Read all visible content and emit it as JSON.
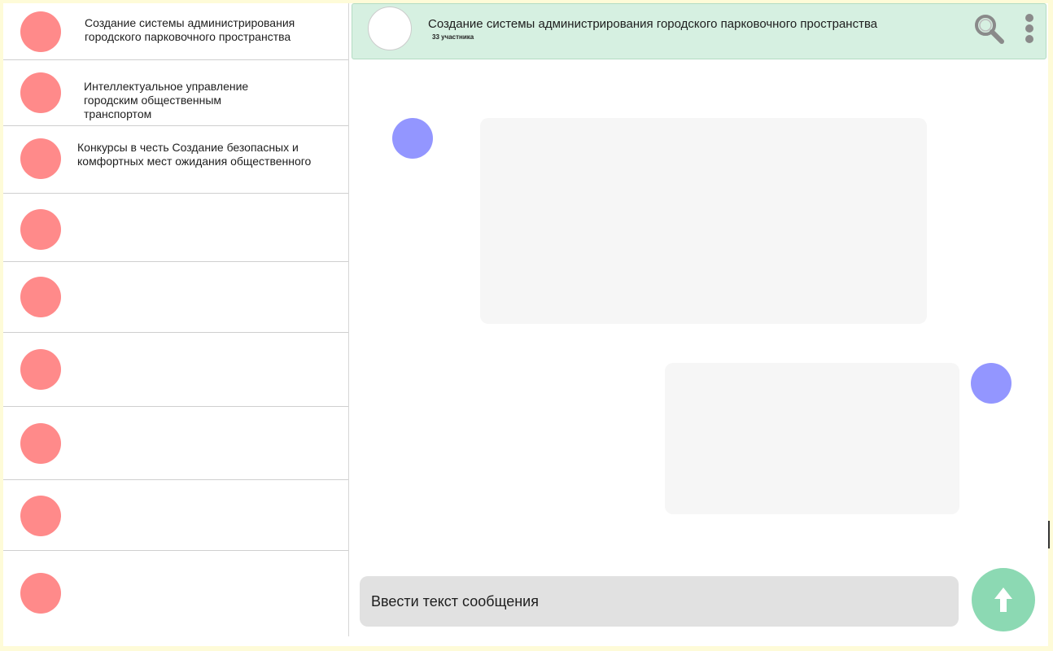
{
  "colors": {
    "background": "#fefbd8",
    "chat_avatar": "#ff8a8a",
    "header_bg": "#d6f0e1",
    "message_avatar": "#9396ff",
    "bubble": "#f6f6f6",
    "input_bg": "#e1e1e1",
    "send_button": "#8cd9b3"
  },
  "sidebar": {
    "chats": [
      {
        "title": "Создание системы администрирования городского парковочного пространства"
      },
      {
        "title": "Интеллектуальное управление городским общественным транспортом"
      },
      {
        "title": "Конкурсы в честь Создание безопасных и комфортных мест ожидания общественного"
      },
      {
        "title": ""
      },
      {
        "title": ""
      },
      {
        "title": ""
      },
      {
        "title": ""
      },
      {
        "title": ""
      },
      {
        "title": ""
      }
    ]
  },
  "header": {
    "title": "Создание системы администрирования городского парковочного пространства",
    "members": "33 участника",
    "search_icon": "search-icon",
    "menu_icon": "more-vertical-icon"
  },
  "composer": {
    "placeholder": "Ввести текст сообщения",
    "send_icon": "arrow-up-icon"
  }
}
